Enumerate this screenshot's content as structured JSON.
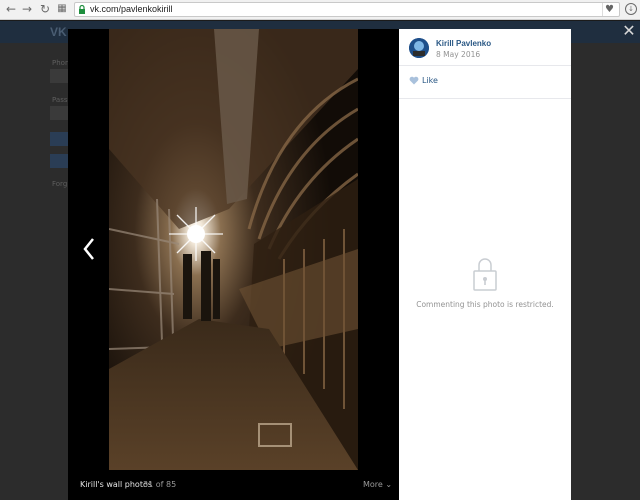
{
  "browser": {
    "url": "vk.com/pavlenkokirill"
  },
  "background_page": {
    "logo": "VK",
    "label_1": "Phon",
    "label_2": "Passw",
    "label_3": "Forg"
  },
  "viewer": {
    "album_title": "Kirill's wall photos",
    "counter": "31 of 85",
    "more_label": "More"
  },
  "panel": {
    "author_name": "Kirill Pavlenko",
    "date": "8 May 2016",
    "like_label": "Like",
    "comments_restricted": "Commenting this photo is restricted."
  },
  "colors": {
    "link": "#2a5885",
    "muted": "#939393",
    "backdrop": "#1b1b1b"
  }
}
